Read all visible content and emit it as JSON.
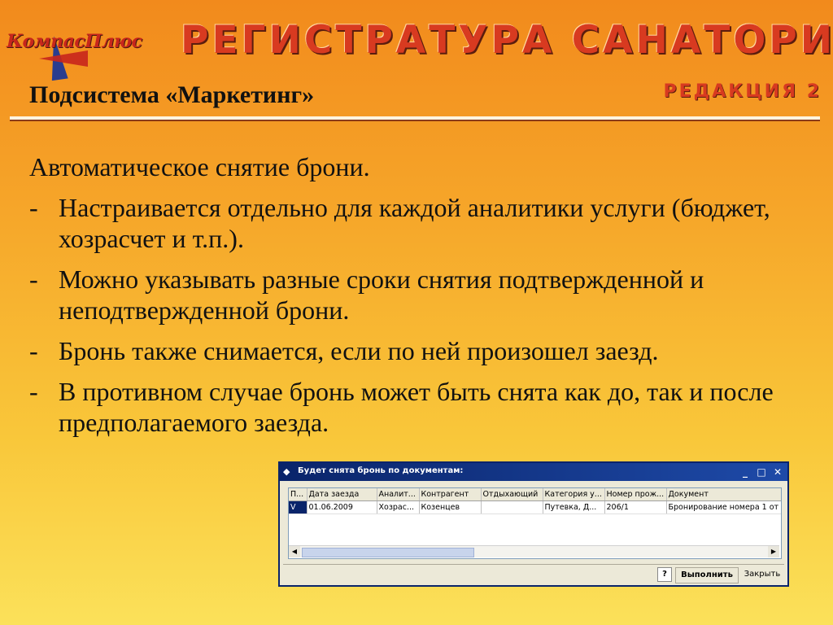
{
  "header": {
    "logo_text": "КомпасПлюс",
    "app_title": "РЕГИСТРАТУРА САНАТОРИЯ",
    "subsystem": "Подсистема «Маркетинг»",
    "edition": "РЕДАКЦИЯ 2"
  },
  "content": {
    "lead": "Автоматическое снятие брони.",
    "bullet_marker": "-",
    "bullets": [
      "Настраивается отдельно для каждой аналитики услуги (бюджет, хозрасчет и т.п.).",
      "Можно указывать разные сроки снятия подтвержденной и неподтвержденной брони.",
      "Бронь также снимается, если по ней произошел заезд.",
      "В противном случае бронь может быть снята как до, так и после предполагаемого заезда."
    ]
  },
  "dialog": {
    "title": "Будет снята бронь по документам:",
    "columns": [
      "П...",
      "Дата заезда",
      "Аналит...",
      "Контрагент",
      "Отдыхающий",
      "Категория у...",
      "Номер прож...",
      "Документ"
    ],
    "rows": [
      [
        "V",
        "01.06.2009",
        "Хозрас...",
        "Козенцев",
        "",
        "Путевка, Д...",
        "206/1",
        "Бронирование номера 1 от"
      ]
    ],
    "help_label": "?",
    "run_label": "Выполнить",
    "close_label": "Закрыть"
  }
}
